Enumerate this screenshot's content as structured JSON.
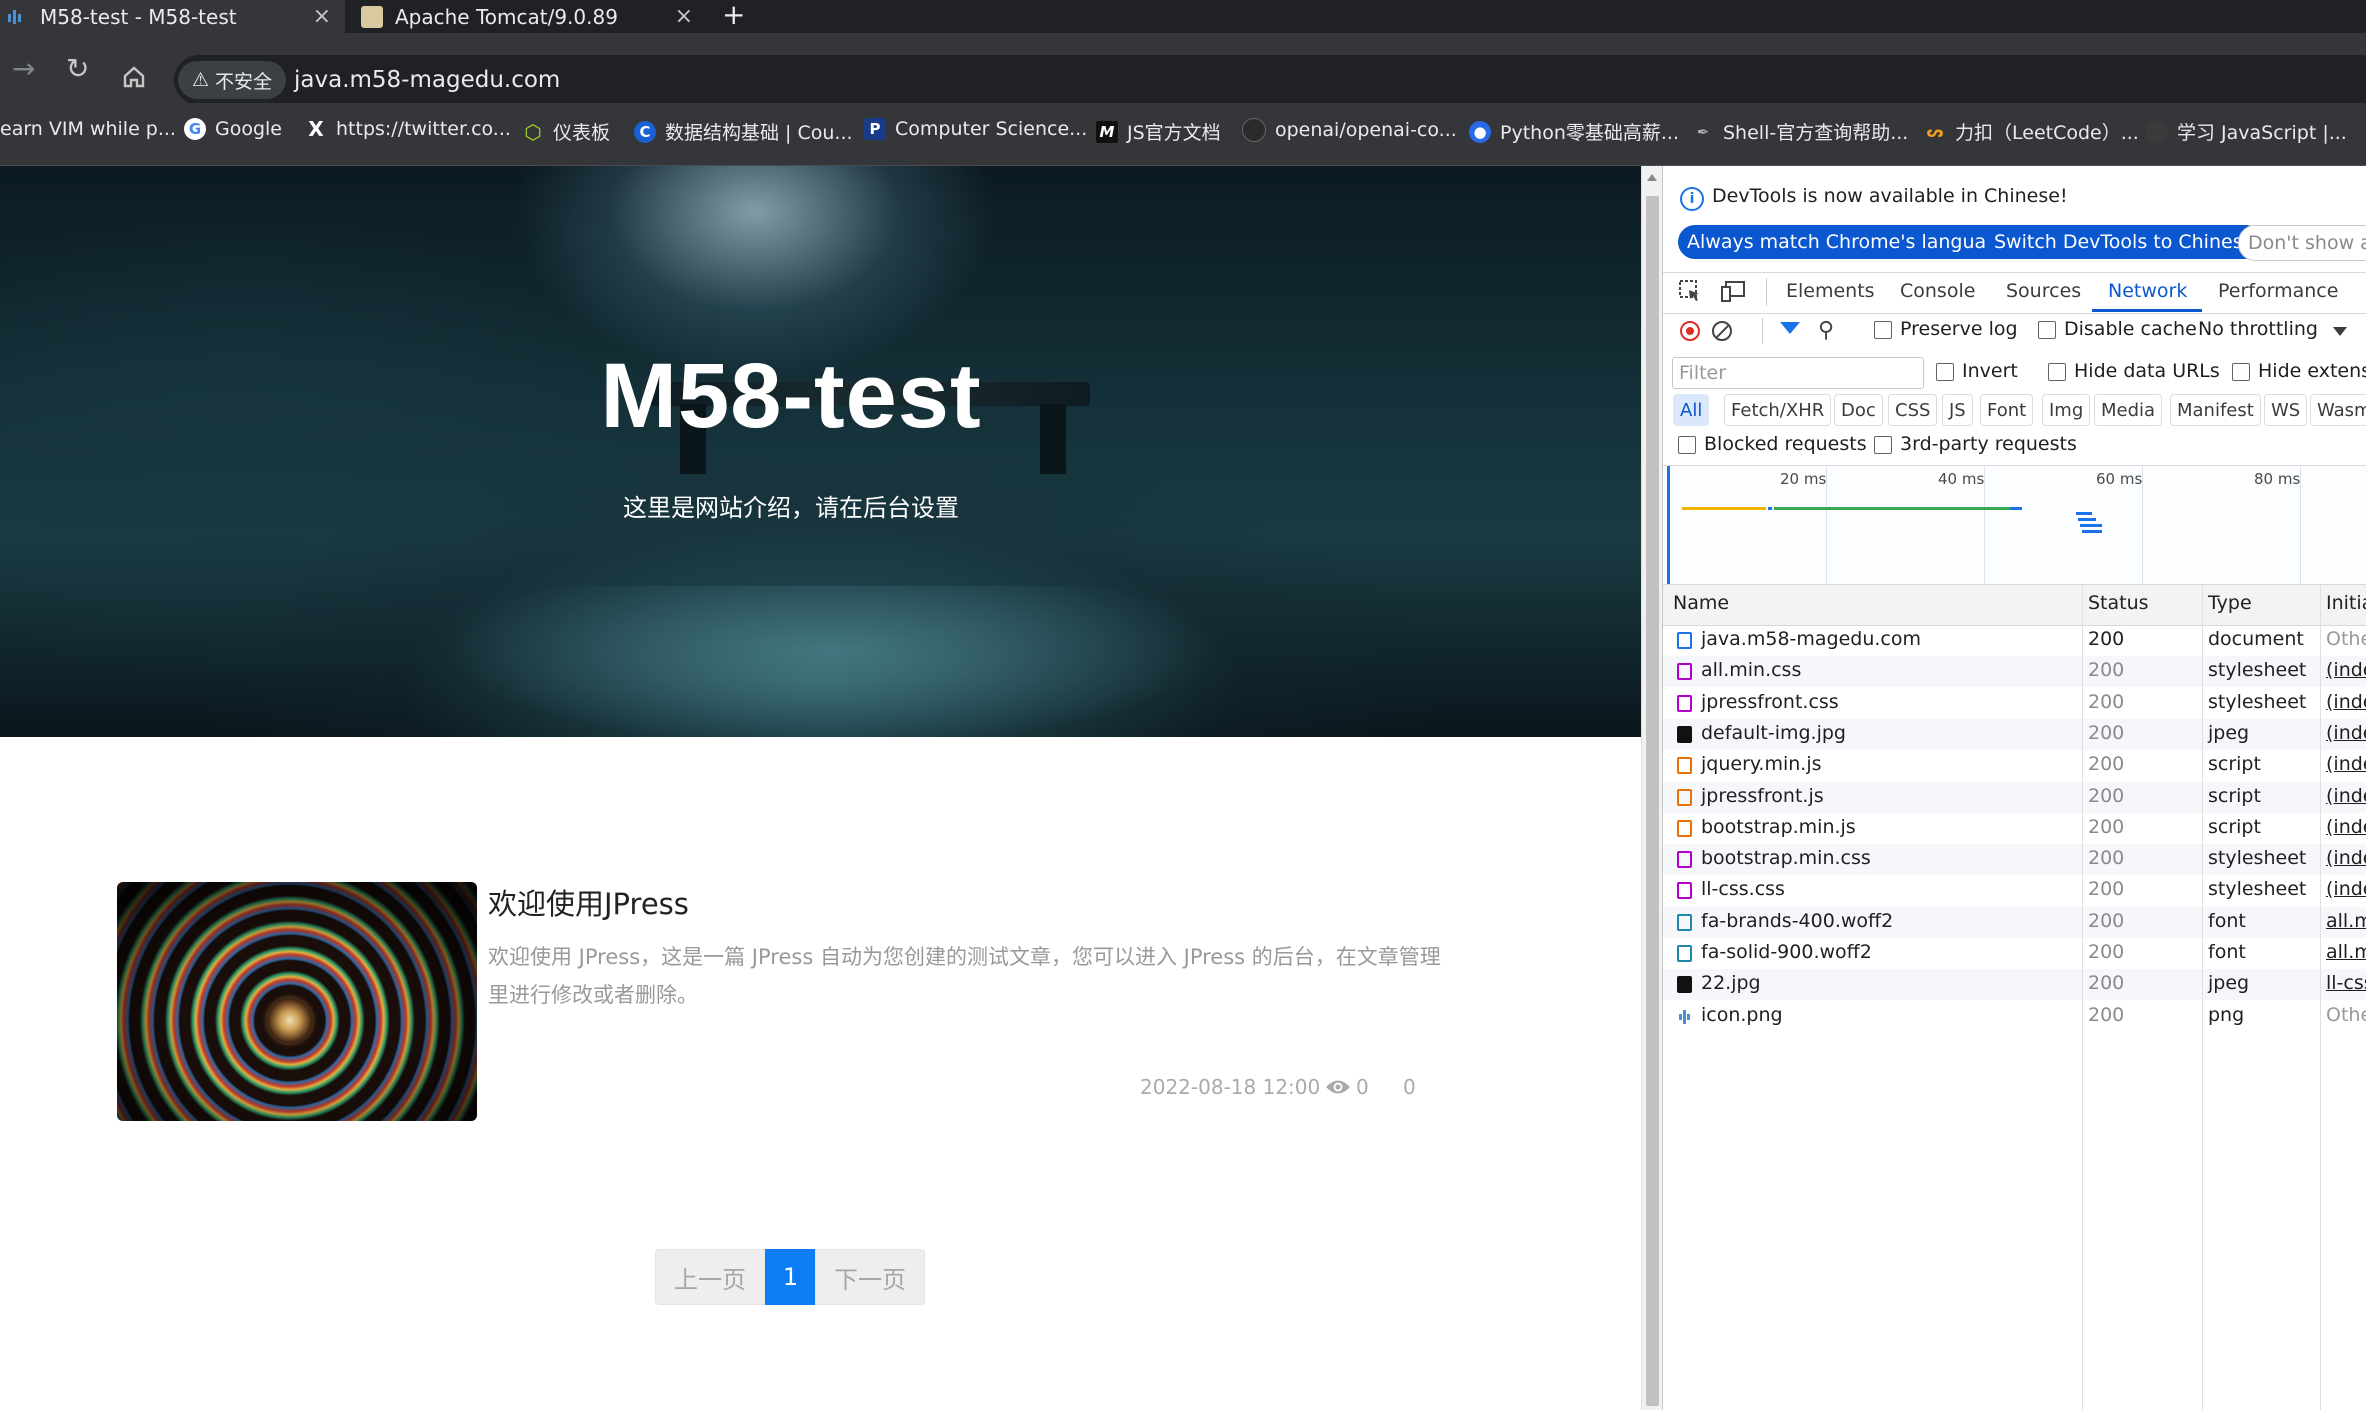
{
  "browser": {
    "tabs": [
      {
        "title": "M58-test - M58-test",
        "active": true,
        "close": "×"
      },
      {
        "title": "Apache Tomcat/9.0.89",
        "active": false,
        "close": "×"
      }
    ],
    "new_tab": "+",
    "security_label": "不安全",
    "url": "java.m58-magedu.com",
    "bookmarks": [
      {
        "label": "earn VIM while p...",
        "icon": "vim-icon"
      },
      {
        "label": "Google",
        "icon": "google-icon"
      },
      {
        "label": "https://twitter.co...",
        "icon": "x-icon"
      },
      {
        "label": "仪表板",
        "icon": "cube-icon"
      },
      {
        "label": "数据结构基础 | Cou...",
        "icon": "c-icon"
      },
      {
        "label": "Computer Science...",
        "icon": "p-icon"
      },
      {
        "label": "JS官方文档",
        "icon": "m-icon"
      },
      {
        "label": "openai/openai-co...",
        "icon": "github-icon"
      },
      {
        "label": "Python零基础高薪...",
        "icon": "blue-circle-icon"
      },
      {
        "label": "Shell-官方查询帮助...",
        "icon": "shell-icon"
      },
      {
        "label": "力扣（LeetCode）...",
        "icon": "leetcode-icon"
      },
      {
        "label": "学习 JavaScript |...",
        "icon": "js-icon"
      }
    ]
  },
  "page": {
    "hero_title": "M58-test",
    "hero_subtitle": "这里是网站介绍，请在后台设置",
    "post": {
      "title": "欢迎使用JPress",
      "excerpt": "欢迎使用 JPress，这是一篇 JPress 自动为您创建的测试文章，您可以进入 JPress 的后台，在文章管理里进行修改或者删除。",
      "date": "2022-08-18 12:00",
      "views": "0",
      "comments": "0"
    },
    "pagination": {
      "prev": "上一页",
      "current": "1",
      "next": "下一页"
    }
  },
  "devtools": {
    "info": "DevTools is now available in Chinese!",
    "buttons": {
      "match": "Always match Chrome's language",
      "switch": "Switch DevTools to Chinese",
      "dont": "Don't show ag"
    },
    "tabs": [
      "Elements",
      "Console",
      "Sources",
      "Network",
      "Performance"
    ],
    "active_tab": "Network",
    "toolbar": {
      "preserve_log": "Preserve log",
      "disable_cache": "Disable cache",
      "throttling": "No throttling"
    },
    "filter_placeholder": "Filter",
    "filter_options": {
      "invert": "Invert",
      "hide_data_urls": "Hide data URLs",
      "hide_extensions": "Hide extensi"
    },
    "type_chips": [
      "All",
      "Fetch/XHR",
      "Doc",
      "CSS",
      "JS",
      "Font",
      "Img",
      "Media",
      "Manifest",
      "WS",
      "Wasm"
    ],
    "blocked_requests": "Blocked requests",
    "third_party": "3rd-party requests",
    "timeline_labels": [
      "20 ms",
      "40 ms",
      "60 ms",
      "80 ms"
    ],
    "columns": [
      "Name",
      "Status",
      "Type",
      "Initia"
    ],
    "requests": [
      {
        "name": "java.m58-magedu.com",
        "status": "200",
        "type": "document",
        "initiator": "Othe",
        "icon": "doc"
      },
      {
        "name": "all.min.css",
        "status": "200",
        "type": "stylesheet",
        "initiator": "(inde",
        "icon": "css"
      },
      {
        "name": "jpressfront.css",
        "status": "200",
        "type": "stylesheet",
        "initiator": "(inde",
        "icon": "css"
      },
      {
        "name": "default-img.jpg",
        "status": "200",
        "type": "jpeg",
        "initiator": "(inde",
        "icon": "img"
      },
      {
        "name": "jquery.min.js",
        "status": "200",
        "type": "script",
        "initiator": "(inde",
        "icon": "js"
      },
      {
        "name": "jpressfront.js",
        "status": "200",
        "type": "script",
        "initiator": "(inde",
        "icon": "js"
      },
      {
        "name": "bootstrap.min.js",
        "status": "200",
        "type": "script",
        "initiator": "(inde",
        "icon": "js"
      },
      {
        "name": "bootstrap.min.css",
        "status": "200",
        "type": "stylesheet",
        "initiator": "(inde",
        "icon": "css"
      },
      {
        "name": "ll-css.css",
        "status": "200",
        "type": "stylesheet",
        "initiator": "(inde",
        "icon": "css"
      },
      {
        "name": "fa-brands-400.woff2",
        "status": "200",
        "type": "font",
        "initiator": "all.m",
        "icon": "font"
      },
      {
        "name": "fa-solid-900.woff2",
        "status": "200",
        "type": "font",
        "initiator": "all.m",
        "icon": "font"
      },
      {
        "name": "22.jpg",
        "status": "200",
        "type": "jpeg",
        "initiator": "ll-css",
        "icon": "img"
      },
      {
        "name": "icon.png",
        "status": "200",
        "type": "png",
        "initiator": "Othe",
        "icon": "png"
      }
    ]
  }
}
